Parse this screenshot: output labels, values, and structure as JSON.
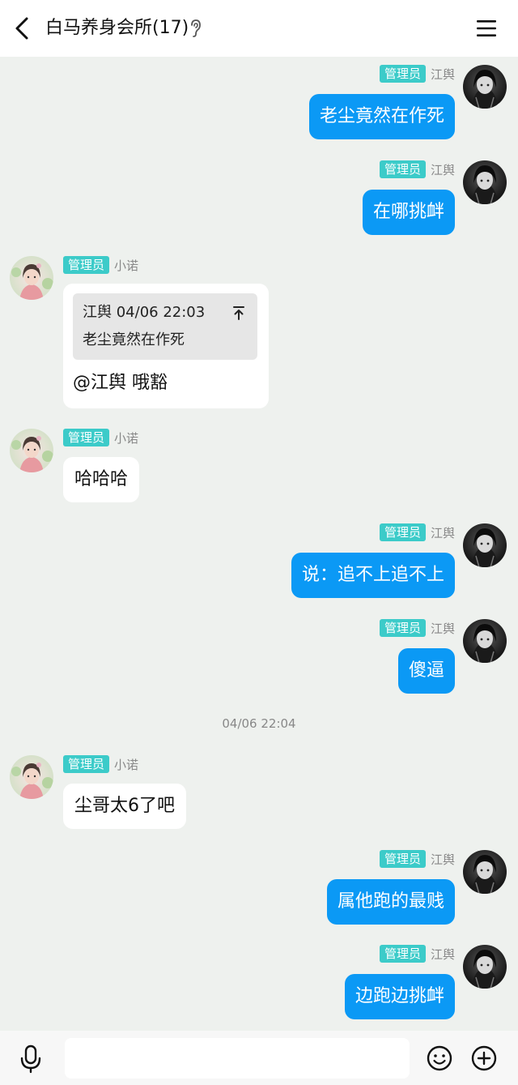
{
  "header": {
    "title": "白马养身会所(17)",
    "back_icon": "chevron-left-icon",
    "ear_icon": "ear-icon",
    "menu_icon": "hamburger-menu-icon"
  },
  "messages": [
    {
      "sender": "江舆",
      "badge": "管理员",
      "text": "老尘竟然在作死"
    },
    {
      "sender": "江舆",
      "badge": "管理员",
      "text": "在哪挑衅"
    },
    {
      "sender": "小诺",
      "badge": "管理员",
      "quote_header": "江舆 04/06 22:03",
      "quote_text": "老尘竟然在作死",
      "text": "@江舆 哦豁"
    },
    {
      "sender": "小诺",
      "badge": "管理员",
      "text": "哈哈哈"
    },
    {
      "sender": "江舆",
      "badge": "管理员",
      "text": "说：追不上追不上"
    },
    {
      "sender": "江舆",
      "badge": "管理员",
      "text": "傻逼"
    },
    {
      "sender": "小诺",
      "badge": "管理员",
      "text": "尘哥太6了吧"
    },
    {
      "sender": "江舆",
      "badge": "管理员",
      "text": "属他跑的最贱"
    },
    {
      "sender": "江舆",
      "badge": "管理员",
      "text": "边跑边挑衅"
    }
  ],
  "timestamp": "04/06 22:04",
  "footer": {
    "mic_icon": "microphone-icon",
    "emoji_icon": "emoji-icon",
    "plus_icon": "plus-icon",
    "input_value": ""
  },
  "colors": {
    "outgoing_bubble": "#0b99f5",
    "badge": "#3ccbc9",
    "background": "#eef1ee"
  }
}
